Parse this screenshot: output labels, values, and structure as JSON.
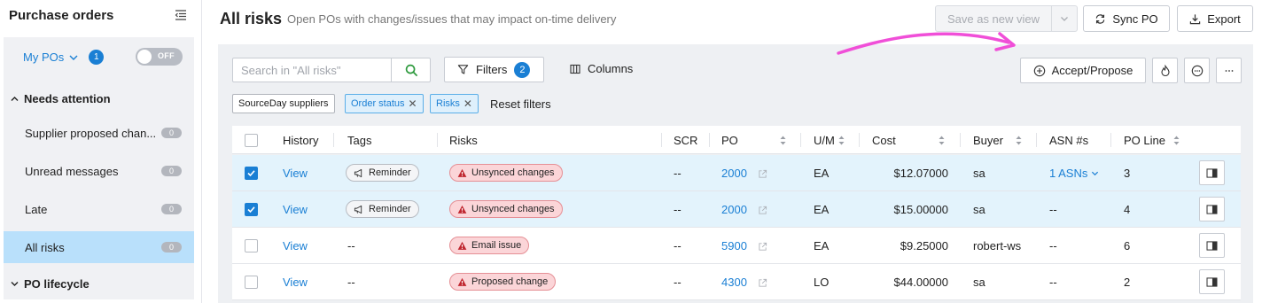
{
  "sidebar": {
    "title": "Purchase orders",
    "my_pos": {
      "label": "My POs",
      "count": "1"
    },
    "toggle_label": "OFF",
    "sections": {
      "needs_attention": "Needs attention",
      "po_lifecycle": "PO lifecycle"
    },
    "items": [
      {
        "label": "Supplier proposed chan...",
        "count": "0"
      },
      {
        "label": "Unread messages",
        "count": "0"
      },
      {
        "label": "Late",
        "count": "0"
      },
      {
        "label": "All risks",
        "count": "0"
      }
    ]
  },
  "header": {
    "title": "All risks",
    "subtitle": "Open POs with changes/issues that may impact on-time delivery",
    "save_view": "Save as new view",
    "sync_po": "Sync PO",
    "export": "Export"
  },
  "toolbar": {
    "search_placeholder": "Search in \"All risks\"",
    "filters_label": "Filters",
    "filters_count": "2",
    "columns_label": "Columns",
    "accept_propose": "Accept/Propose"
  },
  "chips": [
    {
      "label": "SourceDay suppliers",
      "removable": false
    },
    {
      "label": "Order status",
      "removable": true
    },
    {
      "label": "Risks",
      "removable": true
    }
  ],
  "reset_filters": "Reset filters",
  "table": {
    "headers": {
      "history": "History",
      "tags": "Tags",
      "risks": "Risks",
      "scr": "SCR",
      "po": "PO",
      "um": "U/M",
      "cost": "Cost",
      "buyer": "Buyer",
      "asn": "ASN #s",
      "po_line": "PO Line"
    },
    "rows": [
      {
        "selected": true,
        "history": "View",
        "tag": "Reminder",
        "risk": "Unsynced changes",
        "scr": "--",
        "po": "2000",
        "um": "EA",
        "cost": "$12.07000",
        "buyer": "sa",
        "asn": "1 ASNs",
        "po_line": "3"
      },
      {
        "selected": true,
        "history": "View",
        "tag": "Reminder",
        "risk": "Unsynced changes",
        "scr": "--",
        "po": "2000",
        "um": "EA",
        "cost": "$15.00000",
        "buyer": "sa",
        "asn": "--",
        "po_line": "4"
      },
      {
        "selected": false,
        "history": "View",
        "tag": "--",
        "risk": "Email issue",
        "scr": "--",
        "po": "5900",
        "um": "EA",
        "cost": "$9.25000",
        "buyer": "robert-ws",
        "asn": "--",
        "po_line": "6"
      },
      {
        "selected": false,
        "history": "View",
        "tag": "--",
        "risk": "Proposed change",
        "scr": "--",
        "po": "4300",
        "um": "LO",
        "cost": "$44.00000",
        "buyer": "sa",
        "asn": "--",
        "po_line": "2"
      }
    ]
  },
  "colors": {
    "accent": "#1a7fd4",
    "active_nav": "#b9e0fb",
    "selected_row": "#e3f3fc",
    "risk_tag_bg": "#fbd5d8",
    "annotation_arrow": "#f04fd8"
  }
}
